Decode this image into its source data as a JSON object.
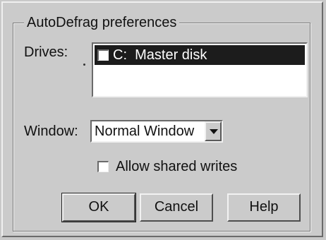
{
  "dialog": {
    "group_title": "AutoDefrag preferences",
    "drives_label": "Drives:",
    "drives": [
      {
        "label": "C:  Master disk",
        "checked": false,
        "selected": true
      }
    ],
    "window_label": "Window:",
    "window_select": {
      "value": "Normal Window"
    },
    "allow_shared_writes": {
      "label": "Allow shared writes",
      "checked": false
    },
    "buttons": {
      "ok": "OK",
      "cancel": "Cancel",
      "help": "Help"
    }
  }
}
